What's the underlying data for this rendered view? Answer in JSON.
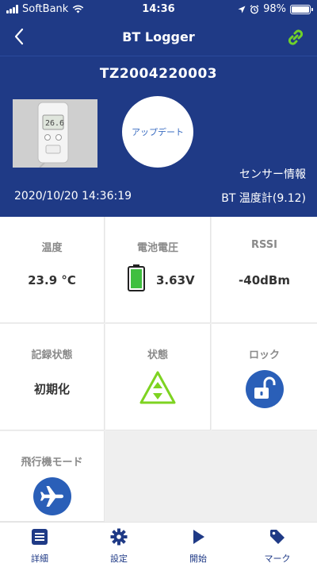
{
  "status_bar": {
    "carrier": "SoftBank",
    "time": "14:36",
    "battery_percent": "98%",
    "battery_level": 0.98
  },
  "nav": {
    "title": "BT Logger"
  },
  "device": {
    "id": "TZ2004220003",
    "update_label": "アップデート",
    "sensor_info_label": "センサー情報",
    "datetime": "2020/10/20 14:36:19",
    "model": "BT 温度計(9.12)"
  },
  "cells": {
    "temperature": {
      "label": "温度",
      "value": "23.9 °C"
    },
    "battery": {
      "label": "電池電圧",
      "value": "3.63V",
      "level": 1.0
    },
    "rssi": {
      "label": "RSSI",
      "value": "-40dBm"
    },
    "recording": {
      "label": "記録状態",
      "value": "初期化"
    },
    "state": {
      "label": "状態"
    },
    "lock": {
      "label": "ロック"
    },
    "airplane": {
      "label": "飛行機モード"
    }
  },
  "tabs": [
    {
      "label": "詳細",
      "icon": "list-icon"
    },
    {
      "label": "設定",
      "icon": "gear-icon"
    },
    {
      "label": "開始",
      "icon": "play-icon"
    },
    {
      "label": "マーク",
      "icon": "tag-icon"
    }
  ],
  "colors": {
    "primary": "#1f3a86",
    "accent_green": "#7ed321",
    "battery_green": "#3fbf3f",
    "icon_blue": "#2a5fb8"
  }
}
